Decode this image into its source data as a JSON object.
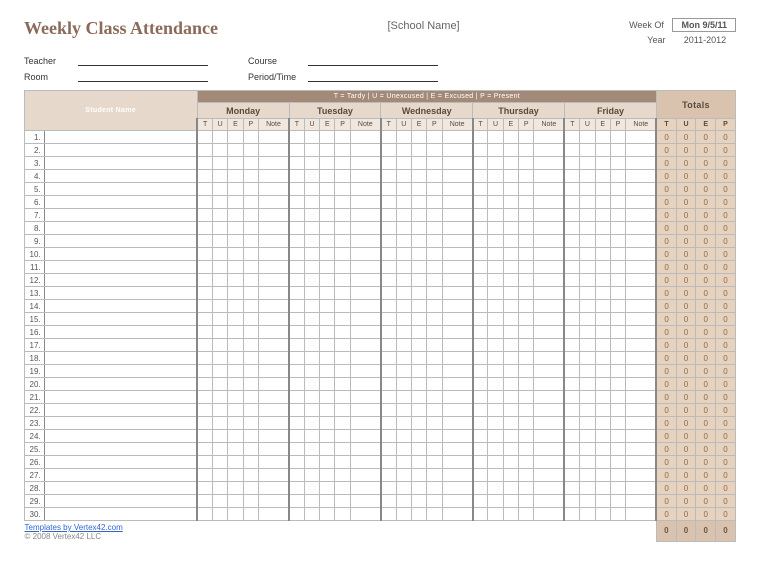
{
  "title": "Weekly Class Attendance",
  "school_name": "[School Name]",
  "week_of_label": "Week Of",
  "week_of_value": "Mon 9/5/11",
  "year_label": "Year",
  "year_value": "2011-2012",
  "teacher_label": "Teacher",
  "room_label": "Room",
  "course_label": "Course",
  "period_label": "Period/Time",
  "legend": "T = Tardy   |   U = Unexcused   |   E = Excused   |   P = Present",
  "student_name_hdr": "Student Name",
  "totals_hdr": "Totals",
  "days": [
    "Monday",
    "Tuesday",
    "Wednesday",
    "Thursday",
    "Friday"
  ],
  "sub_cols": [
    "T",
    "U",
    "E",
    "P",
    "Note"
  ],
  "tot_cols": [
    "T",
    "U",
    "E",
    "P"
  ],
  "row_count": 30,
  "row_totals": [
    0,
    0,
    0,
    0
  ],
  "grand_totals": [
    0,
    0,
    0,
    0
  ],
  "footer_link": "Templates by Vertex42.com",
  "copyright": "© 2008 Vertex42 LLC"
}
